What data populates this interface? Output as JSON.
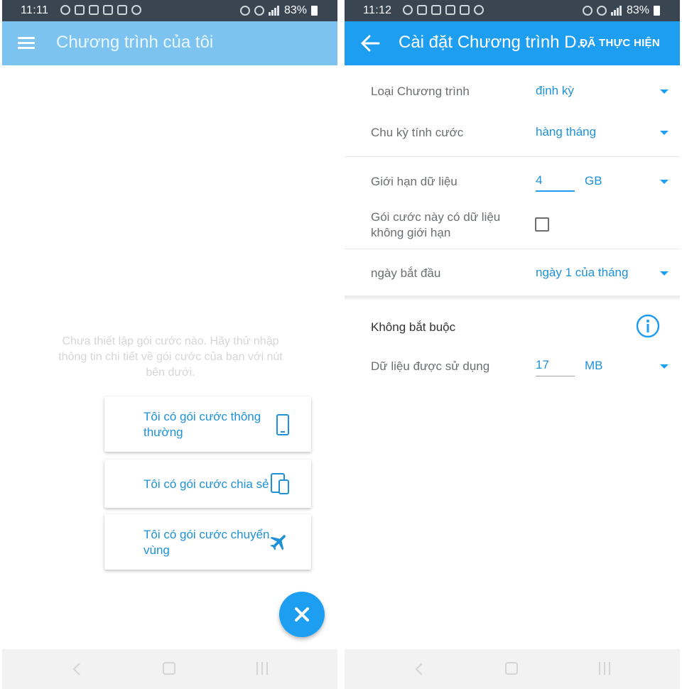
{
  "left": {
    "status": {
      "time": "11:11",
      "battery": "83%"
    },
    "appbar": {
      "title": "Chương trình của tôi",
      "menu_icon": "menu-icon"
    },
    "empty_message": "Chưa thiết lập gói cước nào. Hãy thử nhập thông tin chi tiết về gói cước của bạn với nút bên dưới.",
    "options": [
      {
        "label": "Tôi có gói cước thông thường",
        "icon": "phone-icon"
      },
      {
        "label": "Tôi có gói cước chia sẻ",
        "icon": "devices-icon"
      },
      {
        "label": "Tôi có gói cước chuyển vùng",
        "icon": "airplane-icon"
      }
    ],
    "fab_icon": "close-icon"
  },
  "right": {
    "status": {
      "time": "11:12",
      "battery": "83%"
    },
    "appbar": {
      "title": "Cài đặt Chương trình D...",
      "done": "ĐÃ THỰC HIỆN",
      "back_icon": "arrow-back-icon"
    },
    "plan_type": {
      "label": "Loại Chương trình",
      "value": "định kỳ"
    },
    "billing_cycle": {
      "label": "Chu kỳ tính cước",
      "value": "hàng tháng"
    },
    "data_limit": {
      "label": "Giới hạn dữ liệu",
      "value": "4",
      "unit": "GB"
    },
    "unlimited": {
      "label": "Gói cước này có dữ liệu không giới hạn",
      "checked": false
    },
    "start_date": {
      "label": "ngày bắt đầu",
      "value": "ngày 1 của tháng"
    },
    "optional": {
      "title": "Không bắt buộc",
      "info_icon": "info-icon"
    },
    "data_used": {
      "label": "Dữ liệu được sử dụng",
      "value": "17",
      "unit": "MB"
    }
  },
  "colors": {
    "primary": "#1e9ef0",
    "primary_faded": "#7cc3f0",
    "text_link": "#1e91d8",
    "status_bar": "#3a4552"
  }
}
